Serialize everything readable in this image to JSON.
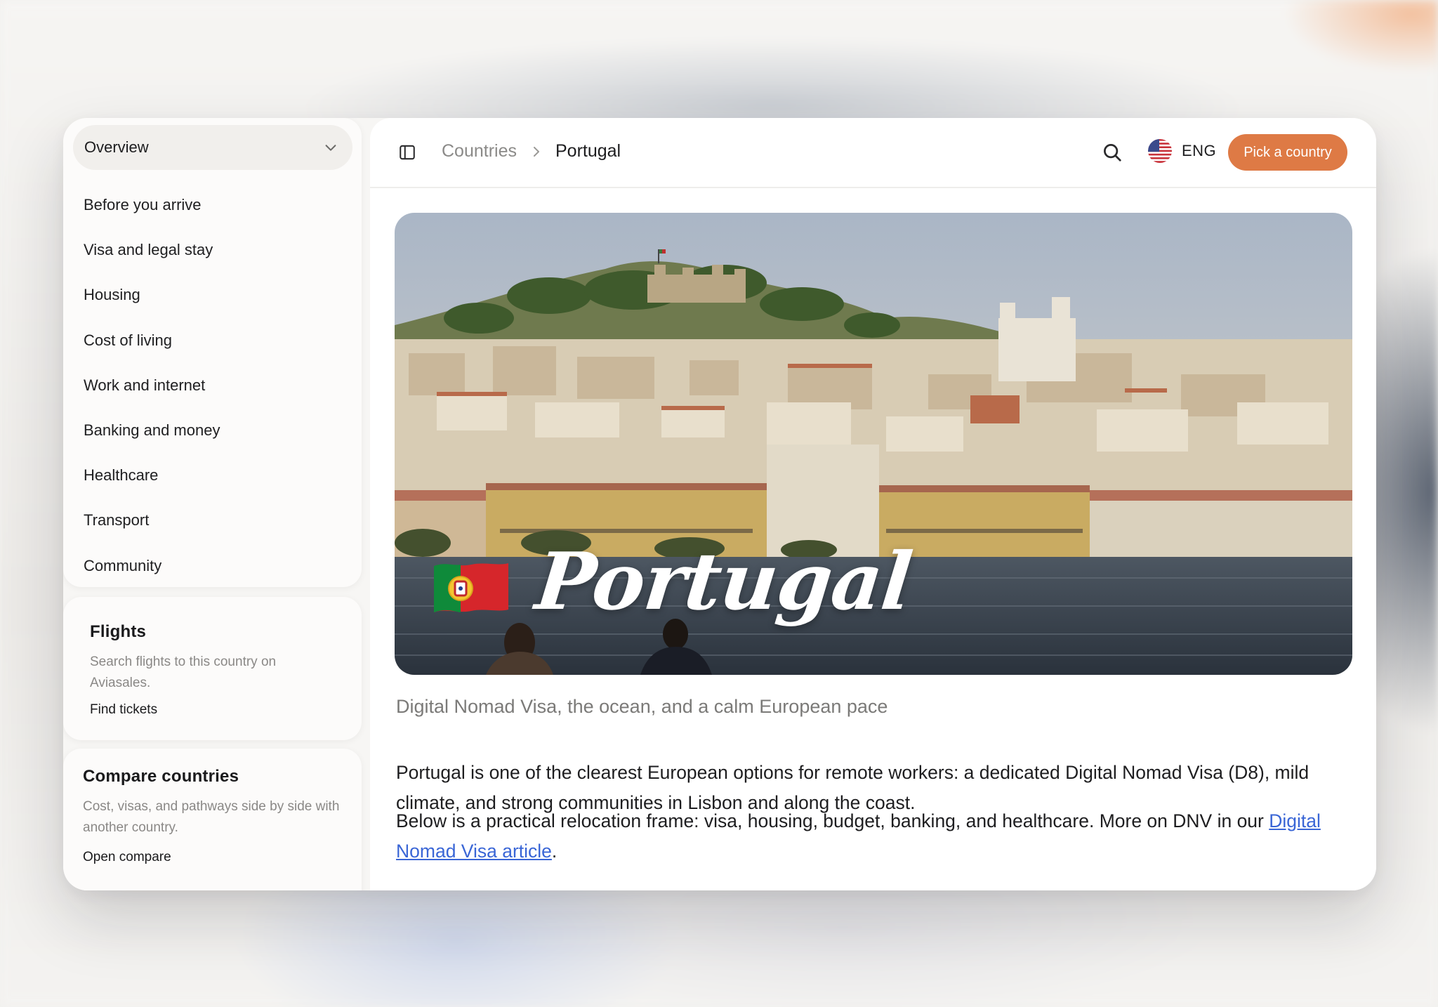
{
  "sidebar": {
    "overview_label": "Overview",
    "items": [
      {
        "label": "Before you arrive"
      },
      {
        "label": "Visa and legal stay"
      },
      {
        "label": "Housing"
      },
      {
        "label": "Cost of living"
      },
      {
        "label": "Work and internet"
      },
      {
        "label": "Banking and money"
      },
      {
        "label": "Healthcare"
      },
      {
        "label": "Transport"
      },
      {
        "label": "Community"
      }
    ],
    "flights": {
      "title": "Flights",
      "description": "Search flights to this country on Aviasales.",
      "link": "Find tickets"
    },
    "compare": {
      "title": "Compare countries",
      "description": "Cost, visas, and pathways side by side with another country.",
      "link": "Open compare"
    }
  },
  "topbar": {
    "breadcrumb": [
      "Countries",
      "Portugal"
    ],
    "language": "ENG",
    "pick_button": "Pick a country"
  },
  "hero": {
    "title": "Portugal",
    "flag_icon": "portugal-flag-icon"
  },
  "content": {
    "subtitle": "Digital Nomad Visa, the ocean, and a calm European pace",
    "paragraph1": "Portugal is one of the clearest European options for remote workers: a dedicated Digital Nomad Visa (D8), mild climate, and strong communities in Lisbon and along the coast.",
    "paragraph2_text": "Below is a practical relocation frame: visa, housing, budget, banking, and healthcare. More on DNV in our ",
    "paragraph2_link": "Digital Nomad Visa article",
    "paragraph2_end": "."
  },
  "colors": {
    "accent": "#de7a45",
    "link": "#3a66d6",
    "muted_text": "#8a8886"
  }
}
